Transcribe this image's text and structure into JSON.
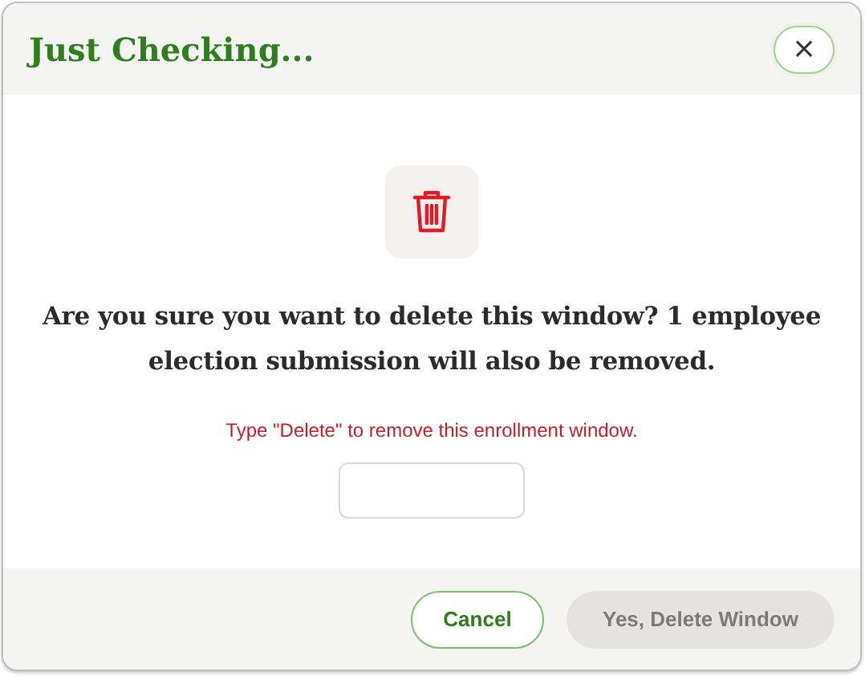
{
  "dialog": {
    "title": "Just Checking...",
    "close_label": "×",
    "message": "Are you sure you want to delete this window? 1 employee election submission will also be removed.",
    "instruction": "Type \"Delete\" to remove this enrollment window.",
    "buttons": [
      {
        "kind": "secondary",
        "label": "Cancel",
        "disabled": false
      },
      {
        "kind": "danger",
        "label": "Yes, Delete Window",
        "disabled": true
      }
    ]
  }
}
